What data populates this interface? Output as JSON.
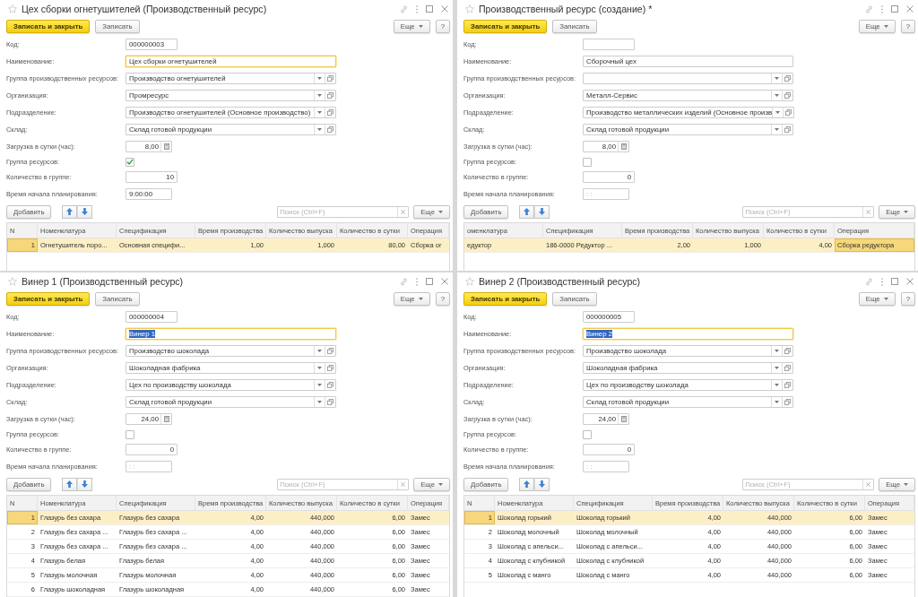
{
  "windows": [
    {
      "title": "Цех сборки огнетушителей (Производственный ресурс)",
      "favorite": false,
      "buttons": [
        {
          "label": "Записать и закрыть",
          "kind": "primary"
        },
        {
          "label": "Записать",
          "kind": "secondary"
        }
      ],
      "more_button": "Еще",
      "help_button": "?",
      "fields": [
        {
          "label": "Код:",
          "kind": "short_input",
          "value": "000000003",
          "focused": false
        },
        {
          "label": "Наименование:",
          "kind": "wide_input",
          "value": "Цех сборки огнетушителей",
          "focused": true,
          "text_selected": false
        },
        {
          "label": "Группа производственных ресурсов:",
          "kind": "select",
          "value": "Производство огнетушителей",
          "focused": false
        },
        {
          "label": "Организация:",
          "kind": "select",
          "value": "Промресурс",
          "focused": false
        },
        {
          "label": "Подразделение:",
          "kind": "select",
          "value": "Производство огнетушителей (Основное производство)",
          "focused": false
        },
        {
          "label": "Склад:",
          "kind": "select",
          "value": "Склад готовой продукции",
          "focused": false
        },
        {
          "label": "Загрузка в сутки (час):",
          "kind": "calculator_input",
          "value": "8,00",
          "focused": false
        },
        {
          "label": "Группа ресурсов:",
          "kind": "checkbox",
          "checked": true
        },
        {
          "label": "Количество в группе:",
          "kind": "number_input",
          "value": "10",
          "focused": false
        },
        {
          "label": "Время начала планирования:",
          "kind": "time_input",
          "value": "9:00:00",
          "focused": false
        }
      ],
      "table_toolbar": {
        "add_button": "Добавить",
        "search": {
          "placeholder": "Поиск (Ctrl+F)"
        },
        "more_button": "Еще"
      },
      "table": {
        "columns": [
          {
            "title": "N",
            "kind": "index",
            "current": true
          },
          {
            "title": "Номенклатура",
            "kind": "text",
            "current": false
          },
          {
            "title": "Спецификация",
            "kind": "text",
            "current": false
          },
          {
            "title": "Время производства",
            "kind": "number",
            "current": false
          },
          {
            "title": "Количество выпуска",
            "kind": "number",
            "current": false
          },
          {
            "title": "Количество в сутки",
            "kind": "number",
            "current": false
          },
          {
            "title": "Операция",
            "kind": "text",
            "current": false
          }
        ],
        "rows": [
          {
            "selected": true,
            "cells": [
              "1",
              "Огнетушитель поро...",
              "Основная специфи...",
              "1,00",
              "1,000",
              "80,00",
              "Сборка ог"
            ]
          }
        ]
      }
    },
    {
      "title": "Производственный ресурс (создание) *",
      "favorite": false,
      "buttons": [
        {
          "label": "Записать и закрыть",
          "kind": "primary"
        },
        {
          "label": "Записать",
          "kind": "secondary"
        }
      ],
      "more_button": "Еще",
      "help_button": "?",
      "fields": [
        {
          "label": "Код:",
          "kind": "short_input",
          "focused": false
        },
        {
          "label": "Наименование:",
          "kind": "wide_input",
          "value": "Сборочный цех",
          "focused": false,
          "text_selected": false
        },
        {
          "label": "Группа производственных ресурсов:",
          "kind": "select",
          "focused": false
        },
        {
          "label": "Организация:",
          "kind": "select",
          "value": "Металл-Сервис",
          "focused": false
        },
        {
          "label": "Подразделение:",
          "kind": "select",
          "value": "Производство металлических изделий (Основное произв",
          "focused": false
        },
        {
          "label": "Склад:",
          "kind": "select",
          "value": "Склад готовой продукции",
          "focused": false
        },
        {
          "label": "Загрузка в сутки (час):",
          "kind": "calculator_input",
          "value": "8,00",
          "focused": false
        },
        {
          "label": "Группа ресурсов:",
          "kind": "checkbox",
          "checked": false
        },
        {
          "label": "Количество в группе:",
          "kind": "number_input",
          "value": "0",
          "focused": false
        },
        {
          "label": "Время начала планирования:",
          "kind": "time_input",
          "placeholder": ": :",
          "focused": false
        }
      ],
      "table_toolbar": {
        "add_button": "Добавить",
        "search": {
          "placeholder": "Поиск (Ctrl+F)"
        },
        "more_button": "Еще"
      },
      "table": {
        "columns": [
          {
            "title": "оменклатура",
            "kind": "text",
            "current": false
          },
          {
            "title": "Спецификация",
            "kind": "text",
            "current": false
          },
          {
            "title": "Время производства",
            "kind": "number",
            "current": false
          },
          {
            "title": "Количество выпуска",
            "kind": "number",
            "current": false
          },
          {
            "title": "Количество в сутки",
            "kind": "number",
            "current": false
          },
          {
            "title": "Операция",
            "kind": "text",
            "current": true
          }
        ],
        "rows": [
          {
            "selected": true,
            "cells": [
              "едуктор",
              "186-0000 Редуктор ...",
              "2,00",
              "1,000",
              "4,00",
              "Сборка редуктора"
            ]
          }
        ]
      }
    },
    {
      "title": "Винер 1 (Производственный ресурс)",
      "favorite": false,
      "buttons": [
        {
          "label": "Записать и закрыть",
          "kind": "primary"
        },
        {
          "label": "Записать",
          "kind": "secondary"
        }
      ],
      "more_button": "Еще",
      "help_button": "?",
      "fields": [
        {
          "label": "Код:",
          "kind": "short_input",
          "value": "000000004",
          "focused": false
        },
        {
          "label": "Наименование:",
          "kind": "wide_input",
          "value": "Винер 1",
          "focused": true,
          "text_selected": true
        },
        {
          "label": "Группа производственных ресурсов:",
          "kind": "select",
          "value": "Производство шоколада",
          "focused": false
        },
        {
          "label": "Организация:",
          "kind": "select",
          "value": "Шоколадная фабрика",
          "focused": false
        },
        {
          "label": "Подразделение:",
          "kind": "select",
          "value": "Цех по производству шоколада",
          "focused": false
        },
        {
          "label": "Склад:",
          "kind": "select",
          "value": "Склад готовой продукции",
          "focused": false
        },
        {
          "label": "Загрузка в сутки (час):",
          "kind": "calculator_input",
          "value": "24,00",
          "focused": false
        },
        {
          "label": "Группа ресурсов:",
          "kind": "checkbox",
          "checked": false
        },
        {
          "label": "Количество в группе:",
          "kind": "number_input",
          "value": "0",
          "focused": false
        },
        {
          "label": "Время начала планирования:",
          "kind": "time_input",
          "placeholder": ": :",
          "focused": false
        }
      ],
      "table_toolbar": {
        "add_button": "Добавить",
        "search": {
          "placeholder": "Поиск (Ctrl+F)"
        },
        "more_button": "Еще"
      },
      "table": {
        "columns": [
          {
            "title": "N",
            "kind": "index",
            "current": true
          },
          {
            "title": "Номенклатура",
            "kind": "text",
            "current": false
          },
          {
            "title": "Спецификация",
            "kind": "text",
            "current": false
          },
          {
            "title": "Время производства",
            "kind": "number",
            "current": false
          },
          {
            "title": "Количество выпуска",
            "kind": "number",
            "current": false
          },
          {
            "title": "Количество в сутки",
            "kind": "number",
            "current": false
          },
          {
            "title": "Операция",
            "kind": "text",
            "current": false
          }
        ],
        "rows": [
          {
            "selected": true,
            "cells": [
              "1",
              "Глазурь без сахара",
              "Глазурь без сахара",
              "4,00",
              "440,000",
              "6,00",
              "Замес"
            ]
          },
          {
            "selected": false,
            "cells": [
              "2",
              "Глазурь без сахара ...",
              "Глазурь без сахара ...",
              "4,00",
              "440,000",
              "6,00",
              "Замес"
            ]
          },
          {
            "selected": false,
            "cells": [
              "3",
              "Глазурь без сахара ...",
              "Глазурь без сахара ...",
              "4,00",
              "440,000",
              "6,00",
              "Замес"
            ]
          },
          {
            "selected": false,
            "cells": [
              "4",
              "Глазурь белая",
              "Глазурь белая",
              "4,00",
              "440,000",
              "6,00",
              "Замес"
            ]
          },
          {
            "selected": false,
            "cells": [
              "5",
              "Глазурь молочная",
              "Глазурь молочная",
              "4,00",
              "440,000",
              "6,00",
              "Замес"
            ]
          },
          {
            "selected": false,
            "cells": [
              "6",
              "Глазурь шоколадная",
              "Глазурь шоколадная",
              "4,00",
              "440,000",
              "6,00",
              "Замес"
            ]
          }
        ]
      }
    },
    {
      "title": "Винер 2 (Производственный ресурс)",
      "favorite": false,
      "buttons": [
        {
          "label": "Записать и закрыть",
          "kind": "primary"
        },
        {
          "label": "Записать",
          "kind": "secondary"
        }
      ],
      "more_button": "Еще",
      "help_button": "?",
      "fields": [
        {
          "label": "Код:",
          "kind": "short_input",
          "value": "000000005",
          "focused": false
        },
        {
          "label": "Наименование:",
          "kind": "wide_input",
          "value": "Винер 2",
          "focused": true,
          "text_selected": true
        },
        {
          "label": "Группа производственных ресурсов:",
          "kind": "select",
          "value": "Производство шоколада",
          "focused": false
        },
        {
          "label": "Организация:",
          "kind": "select",
          "value": "Шоколадная фабрика",
          "focused": false
        },
        {
          "label": "Подразделение:",
          "kind": "select",
          "value": "Цех по производству шоколада",
          "focused": false
        },
        {
          "label": "Склад:",
          "kind": "select",
          "value": "Склад готовой продукции",
          "focused": false
        },
        {
          "label": "Загрузка в сутки (час):",
          "kind": "calculator_input",
          "value": "24,00",
          "focused": false
        },
        {
          "label": "Группа ресурсов:",
          "kind": "checkbox",
          "checked": false
        },
        {
          "label": "Количество в группе:",
          "kind": "number_input",
          "value": "0",
          "focused": false
        },
        {
          "label": "Время начала планирования:",
          "kind": "time_input",
          "placeholder": ": :",
          "focused": false
        }
      ],
      "table_toolbar": {
        "add_button": "Добавить",
        "search": {
          "placeholder": "Поиск (Ctrl+F)"
        },
        "more_button": "Еще"
      },
      "table": {
        "columns": [
          {
            "title": "N",
            "kind": "index",
            "current": true
          },
          {
            "title": "Номенклатура",
            "kind": "text",
            "current": false
          },
          {
            "title": "Спецификация",
            "kind": "text",
            "current": false
          },
          {
            "title": "Время производства",
            "kind": "number",
            "current": false
          },
          {
            "title": "Количество выпуска",
            "kind": "number",
            "current": false
          },
          {
            "title": "Количество в сутки",
            "kind": "number",
            "current": false
          },
          {
            "title": "Операция",
            "kind": "text",
            "current": false
          }
        ],
        "rows": [
          {
            "selected": true,
            "cells": [
              "1",
              "Шоколад горький",
              "Шоколад горький",
              "4,00",
              "440,000",
              "6,00",
              "Замес"
            ]
          },
          {
            "selected": false,
            "cells": [
              "2",
              "Шоколад молочный",
              "Шоколад молочный",
              "4,00",
              "440,000",
              "6,00",
              "Замес"
            ]
          },
          {
            "selected": false,
            "cells": [
              "3",
              "Шоколад с апельси...",
              "Шоколад с апельси...",
              "4,00",
              "440,000",
              "6,00",
              "Замес"
            ]
          },
          {
            "selected": false,
            "cells": [
              "4",
              "Шоколад с клубникой",
              "Шоколад с клубникой",
              "4,00",
              "440,000",
              "6,00",
              "Замес"
            ]
          },
          {
            "selected": false,
            "cells": [
              "5",
              "Шоколад с манго",
              "Шоколад с манго",
              "4,00",
              "440,000",
              "6,00",
              "Замес"
            ]
          }
        ]
      }
    }
  ]
}
